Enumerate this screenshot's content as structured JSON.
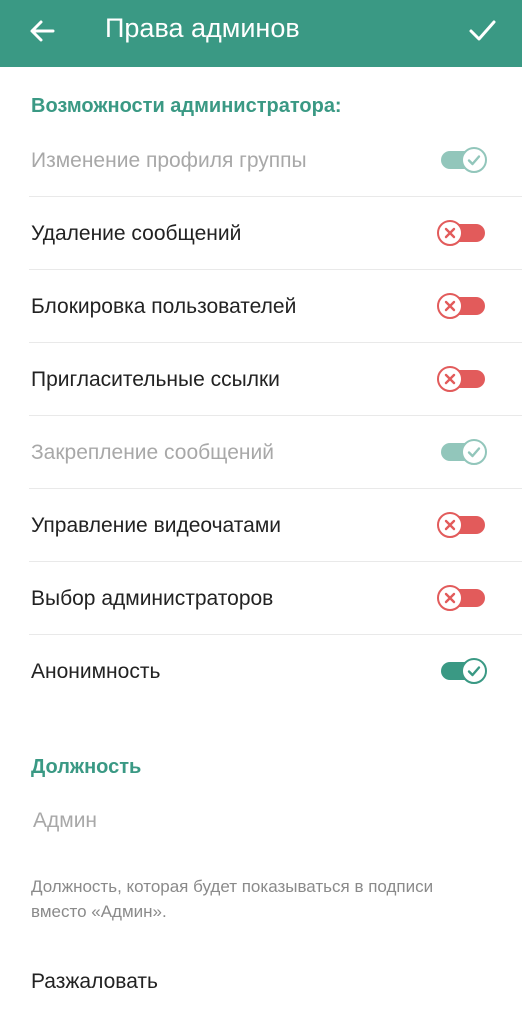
{
  "appbar": {
    "title": "Права админов",
    "back_icon": "arrow-left-icon",
    "done_icon": "checkmark-icon",
    "color": "#3a9984"
  },
  "permissions": {
    "header": "Возможности администратора:",
    "items": [
      {
        "label": "Изменение профиля группы",
        "state": "on",
        "enabled": false
      },
      {
        "label": "Удаление сообщений",
        "state": "off",
        "enabled": true
      },
      {
        "label": "Блокировка пользователей",
        "state": "off",
        "enabled": true
      },
      {
        "label": "Пригласительные ссылки",
        "state": "off",
        "enabled": true
      },
      {
        "label": "Закрепление сообщений",
        "state": "on",
        "enabled": false
      },
      {
        "label": "Управление видеочатами",
        "state": "off",
        "enabled": true
      },
      {
        "label": "Выбор администраторов",
        "state": "off",
        "enabled": true
      },
      {
        "label": "Анонимность",
        "state": "on",
        "enabled": true
      }
    ]
  },
  "rank": {
    "header": "Должность",
    "placeholder": "Админ",
    "hint": "Должность, которая будет показываться в подписи вместо «Админ»."
  },
  "dismiss_label": "Разжаловать",
  "colors": {
    "accent": "#3a9984",
    "off": "#e25b5b",
    "disabled_text": "#a8a8a8"
  }
}
